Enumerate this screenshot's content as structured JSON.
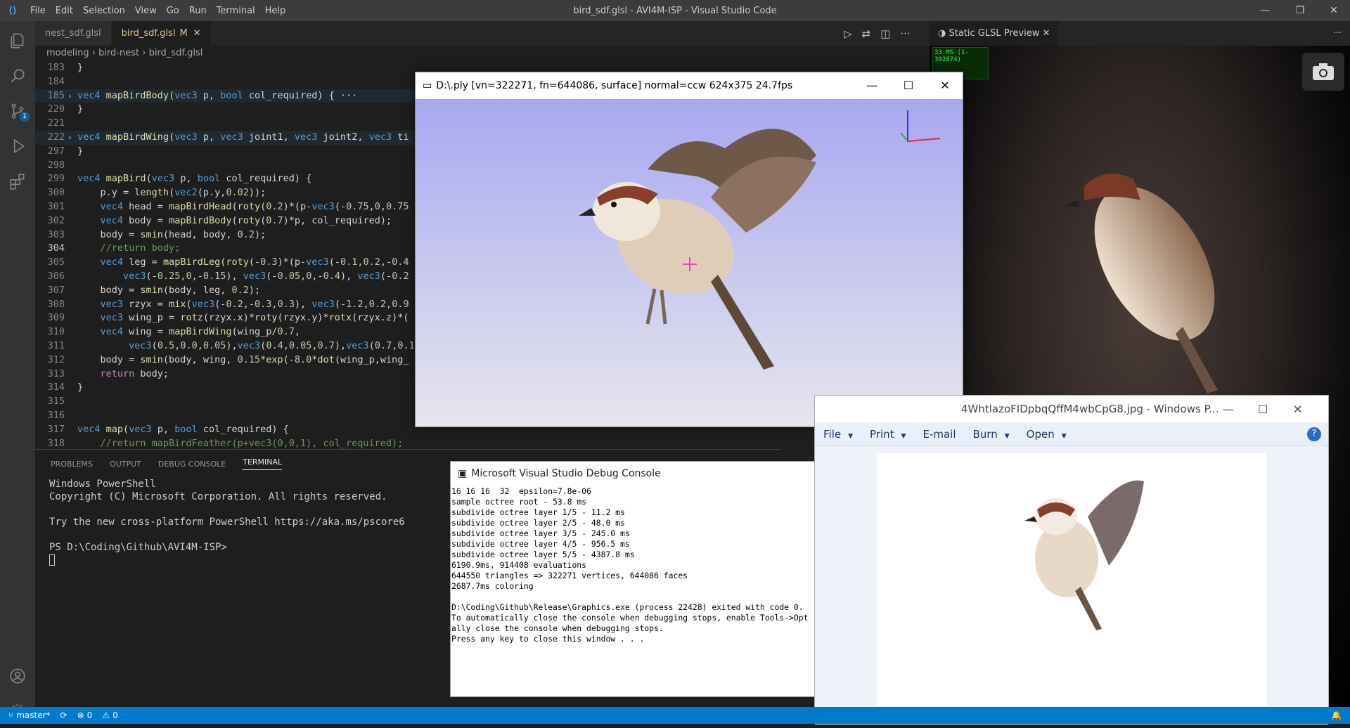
{
  "titlebar": {
    "menu": [
      "File",
      "Edit",
      "Selection",
      "View",
      "Go",
      "Run",
      "Terminal",
      "Help"
    ],
    "title": "bird_sdf.glsl - AVI4M-ISP - Visual Studio Code"
  },
  "activity": {
    "scm_badge": "1"
  },
  "tabs": [
    {
      "label": "nest_sdf.glsl"
    },
    {
      "label": "bird_sdf.glsl",
      "modified": "M"
    }
  ],
  "breadcrumb": {
    "parts": [
      "modeling",
      "bird-nest",
      "bird_sdf.glsl"
    ]
  },
  "editor": {
    "lines": [
      {
        "n": "183",
        "t": "}"
      },
      {
        "n": "184",
        "t": ""
      },
      {
        "n": "185",
        "t": "vec4 mapBirdBody(vec3 p, bool col_required) { ···",
        "fold": true
      },
      {
        "n": "220",
        "t": "}"
      },
      {
        "n": "221",
        "t": ""
      },
      {
        "n": "222",
        "t": "vec4 mapBirdWing(vec3 p, vec3 joint1, vec3 joint2, vec3 ti",
        "fold": true
      },
      {
        "n": "297",
        "t": "}"
      },
      {
        "n": "298",
        "t": ""
      },
      {
        "n": "299",
        "t": "vec4 mapBird(vec3 p, bool col_required) {"
      },
      {
        "n": "300",
        "t": "    p.y = length(vec2(p.y,0.02));"
      },
      {
        "n": "301",
        "t": "    vec4 head = mapBirdHead(roty(0.2)*(p-vec3(-0.75,0,0.75"
      },
      {
        "n": "302",
        "t": "    vec4 body = mapBirdBody(roty(0.7)*p, col_required);"
      },
      {
        "n": "303",
        "t": "    body = smin(head, body, 0.2);"
      },
      {
        "n": "304",
        "t": "    //return body;",
        "cur": true
      },
      {
        "n": "305",
        "t": "    vec4 leg = mapBirdLeg(roty(-0.3)*(p-vec3(-0.1,0.2,-0.4"
      },
      {
        "n": "306",
        "t": "        vec3(-0.25,0,-0.15), vec3(-0.05,0,-0.4), vec3(-0.2"
      },
      {
        "n": "307",
        "t": "    body = smin(body, leg, 0.2);"
      },
      {
        "n": "308",
        "t": "    vec3 rzyx = mix(vec3(-0.2,-0.3,0.3), vec3(-1.2,0.2,0.9"
      },
      {
        "n": "309",
        "t": "    vec3 wing_p = rotz(rzyx.x)*roty(rzyx.y)*rotx(rzyx.z)*("
      },
      {
        "n": "310",
        "t": "    vec4 wing = mapBirdWing(wing_p/0.7,"
      },
      {
        "n": "311",
        "t": "         vec3(0.5,0.0,0.05),vec3(0.4,0.05,0.7),vec3(0.7,0.1"
      },
      {
        "n": "312",
        "t": "    body = smin(body, wing, 0.15*exp(-8.0*dot(wing_p,wing_"
      },
      {
        "n": "313",
        "t": "    return body;"
      },
      {
        "n": "314",
        "t": "}"
      },
      {
        "n": "315",
        "t": ""
      },
      {
        "n": "316",
        "t": ""
      },
      {
        "n": "317",
        "t": "vec4 map(vec3 p, bool col_required) {"
      },
      {
        "n": "318",
        "t": "    //return mapBirdFeather(p+vec3(0,0,1), col_required);"
      }
    ]
  },
  "panel": {
    "tabs": [
      "PROBLEMS",
      "OUTPUT",
      "DEBUG CONSOLE",
      "TERMINAL"
    ],
    "terminal": [
      "Windows PowerShell",
      "Copyright (C) Microsoft Corporation. All rights reserved.",
      "",
      "Try the new cross-platform PowerShell https://aka.ms/pscore6",
      "",
      "PS D:\\Coding\\Github\\AVI4M-ISP> "
    ]
  },
  "statusbar": {
    "branch": "master*",
    "errors": "0",
    "warnings": "0"
  },
  "glsl": {
    "tab": "Static GLSL Preview",
    "fps": "33 MS (1-392874)"
  },
  "ply": {
    "title": "D:\\.ply [vn=322271, fn=644086, surface]  normal=ccw   624x375 24.7fps"
  },
  "debug": {
    "title": "Microsoft Visual Studio Debug Console",
    "lines": [
      "16 16 16  32  epsilon=7.8e-06",
      "sample octree root - 53.8 ms",
      "subdivide octree layer 1/5 - 11.2 ms",
      "subdivide octree layer 2/5 - 48.0 ms",
      "subdivide octree layer 3/5 - 245.0 ms",
      "subdivide octree layer 4/5 - 956.5 ms",
      "subdivide octree layer 5/5 - 4387.8 ms",
      "6190.9ms, 914408 evaluations",
      "644550 triangles => 322271 vertices, 644086 faces",
      "2687.7ms coloring",
      "",
      "D:\\Coding\\Github\\Release\\Graphics.exe (process 22428) exited with code 0.",
      "To automatically close the console when debugging stops, enable Tools->Opt",
      "ally close the console when debugging stops.",
      "Press any key to close this window . . ."
    ]
  },
  "photo": {
    "title": "4WhtlazoFIDpbqQffM4wbCpG8.jpg - Windows P...",
    "menu": [
      "File",
      "Print",
      "E-mail",
      "Burn",
      "Open"
    ]
  },
  "colors": {
    "accent": "#007acc",
    "modified": "#e2c08d",
    "sky_top": "#a8a8f0",
    "sky_bottom": "#e6e6ee"
  }
}
